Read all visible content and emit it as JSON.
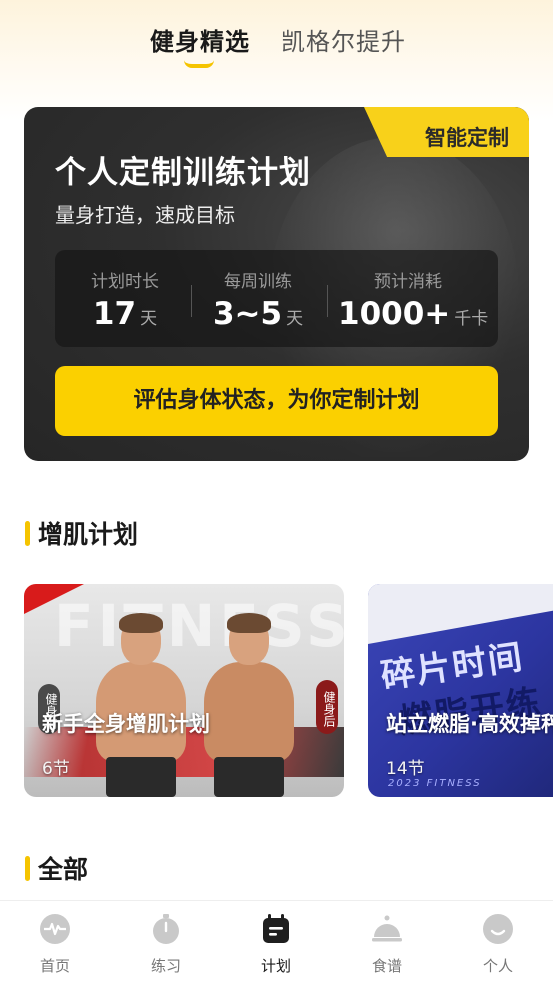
{
  "header": {
    "tabs": [
      {
        "label": "健身精选",
        "active": true
      },
      {
        "label": "凯格尔提升",
        "active": false
      }
    ]
  },
  "plan_card": {
    "badge": "智能定制",
    "title": "个人定制训练计划",
    "subtitle": "量身打造，速成目标",
    "stats": [
      {
        "label": "计划时长",
        "value": "17",
        "unit": "天"
      },
      {
        "label": "每周训练",
        "value": "3~5",
        "unit": "天"
      },
      {
        "label": "预计消耗",
        "value": "1000+",
        "unit": "千卡"
      }
    ],
    "cta": "评估身体状态，为你定制计划"
  },
  "muscle_section": {
    "title": "增肌计划",
    "courses": [
      {
        "name": "新手全身增肌计划",
        "lessons": "6节",
        "tag_before": "健身前",
        "tag_after": "健身后",
        "watermark": "FITNESS"
      },
      {
        "name": "站立燃脂·高效掉秤",
        "lessons": "14节",
        "art_text_1": "碎片时间",
        "art_text_2": "燃脂开练",
        "art_footer": "2023 FITNESS"
      }
    ]
  },
  "all_section": {
    "title": "全部"
  },
  "tabbar": {
    "items": [
      {
        "label": "首页",
        "icon": "heartbeat-icon",
        "active": false
      },
      {
        "label": "练习",
        "icon": "stopwatch-icon",
        "active": false
      },
      {
        "label": "计划",
        "icon": "calendar-icon",
        "active": true
      },
      {
        "label": "食谱",
        "icon": "cloche-icon",
        "active": false
      },
      {
        "label": "个人",
        "icon": "face-icon",
        "active": false
      }
    ]
  },
  "colors": {
    "accent": "#f5c400",
    "card_dark": "#2f2f2f",
    "course_blue": "#2c35a0"
  }
}
